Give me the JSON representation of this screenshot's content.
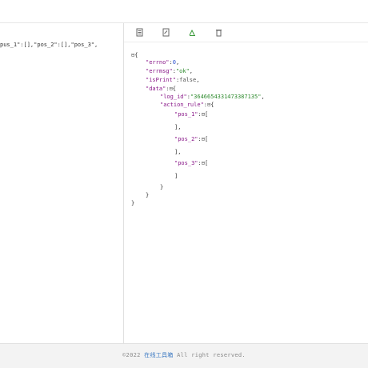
{
  "left": {
    "code": "pus_1\":[],\"pos_2\":[],\"pos_3\","
  },
  "toolbar": {
    "icons": [
      "copy-icon",
      "download-icon",
      "tree-icon",
      "delete-icon"
    ]
  },
  "json_view": {
    "root_toggle": "⊟",
    "open_brace": "{",
    "close_brace": "}",
    "fields": {
      "errno_key": "\"errno\"",
      "errno_val": "0",
      "errmsg_key": "\"errmsg\"",
      "errmsg_val": "\"ok\"",
      "isprint_key": "\"isPrint\"",
      "isprint_val": "false",
      "data_key": "\"data\"",
      "log_id_key": "\"log_id\"",
      "log_id_val": "\"3646654331473387135\"",
      "action_rule_key": "\"action_rule\"",
      "pos_1_key": "\"pos_1\"",
      "pos_2_key": "\"pos_2\"",
      "pos_3_key": "\"pos_3\""
    }
  },
  "footer": {
    "prefix": "©2022 ",
    "link": "在线工具箱",
    "suffix": " All right reserved."
  }
}
